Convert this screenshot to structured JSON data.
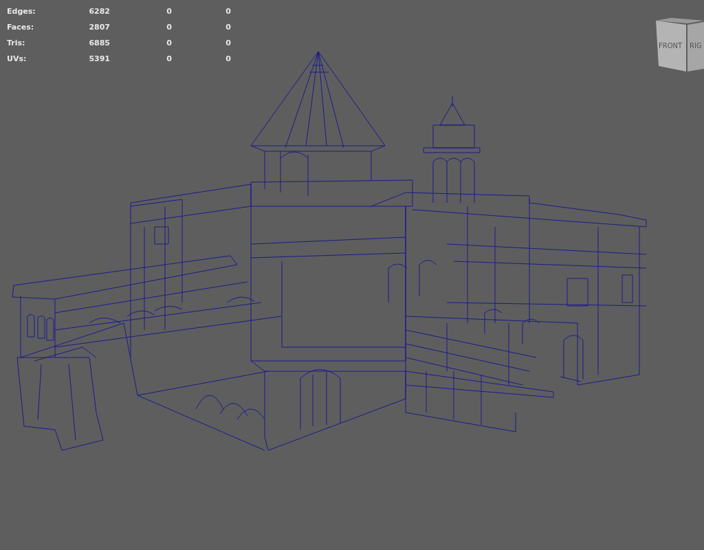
{
  "stats": [
    {
      "label": "Edges:",
      "values": [
        "6282",
        "0",
        "0"
      ]
    },
    {
      "label": "Faces:",
      "values": [
        "2807",
        "0",
        "0"
      ]
    },
    {
      "label": "Tris:",
      "values": [
        "6885",
        "0",
        "0"
      ]
    },
    {
      "label": "UVs:",
      "values": [
        "5391",
        "0",
        "0"
      ]
    }
  ],
  "view_cube": {
    "front": "FRONT",
    "right": "RIG"
  }
}
